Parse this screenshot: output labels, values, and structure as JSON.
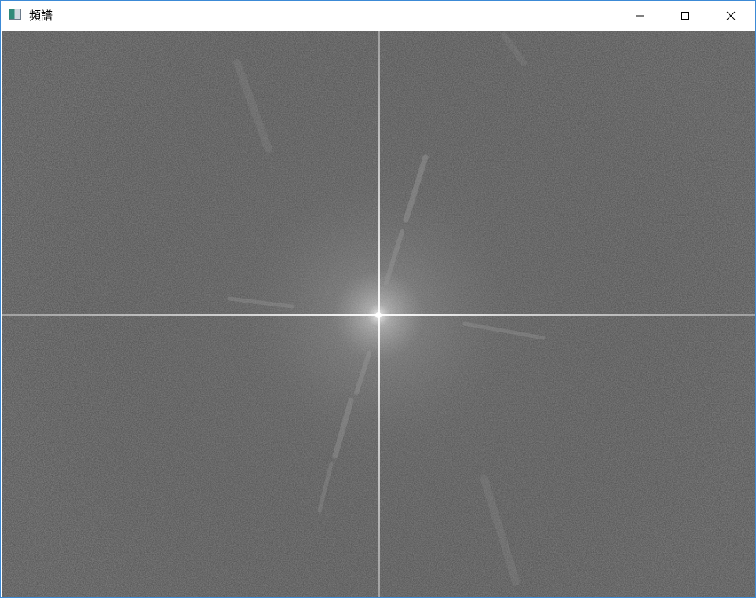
{
  "window": {
    "title": "頻譜",
    "icon": "app-window-icon",
    "controls": {
      "minimize_icon": "minimize-icon",
      "maximize_icon": "maximize-icon",
      "close_icon": "close-icon"
    }
  },
  "spectrum": {
    "description_kind": "fourier-magnitude-spectrum",
    "background_color": "#4a4a4a",
    "axis_line_color": "#d8d8d8",
    "center_glow_color": "#ffffff"
  }
}
